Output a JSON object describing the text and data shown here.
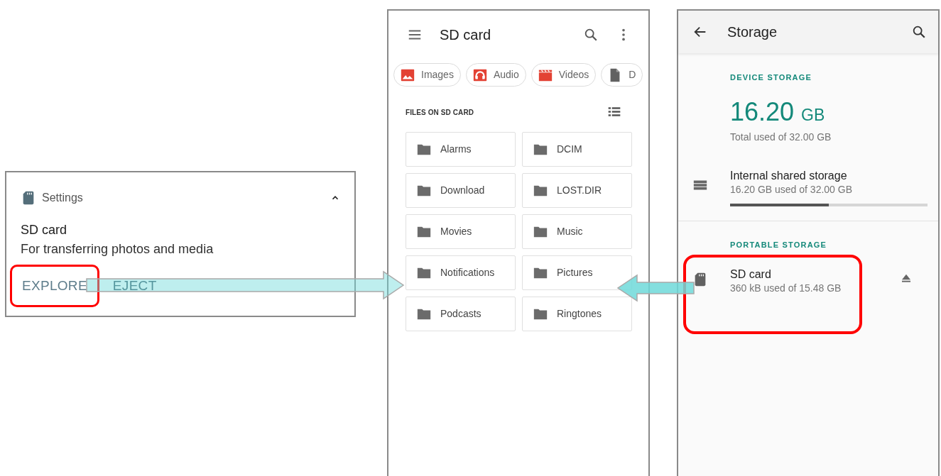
{
  "notification": {
    "app": "Settings",
    "expanded": true,
    "title": "SD card",
    "text": "For transferring photos and media",
    "actions": [
      {
        "label": "EXPLORE",
        "highlighted": true
      },
      {
        "label": "EJECT",
        "highlighted": false
      }
    ]
  },
  "files_app": {
    "title": "SD card",
    "chips": [
      {
        "label": "Images",
        "kind": "images"
      },
      {
        "label": "Audio",
        "kind": "audio"
      },
      {
        "label": "Videos",
        "kind": "videos"
      },
      {
        "label": "D",
        "kind": "documents"
      }
    ],
    "section": "FILES ON SD CARD",
    "folders": [
      "Alarms",
      "DCIM",
      "Download",
      "LOST.DIR",
      "Movies",
      "Music",
      "Notifications",
      "Pictures",
      "Podcasts",
      "Ringtones"
    ]
  },
  "storage": {
    "title": "Storage",
    "device_header": "DEVICE STORAGE",
    "used_value": "16.20",
    "used_unit": "GB",
    "used_caption": "Total used of 32.00 GB",
    "internal": {
      "name": "Internal shared storage",
      "usage": "16.20 GB used of 32.00 GB",
      "level": 0.5
    },
    "portable_header": "PORTABLE STORAGE",
    "sd": {
      "name": "SD card",
      "usage": "360 kB used of 15.48 GB",
      "highlighted": true
    }
  }
}
